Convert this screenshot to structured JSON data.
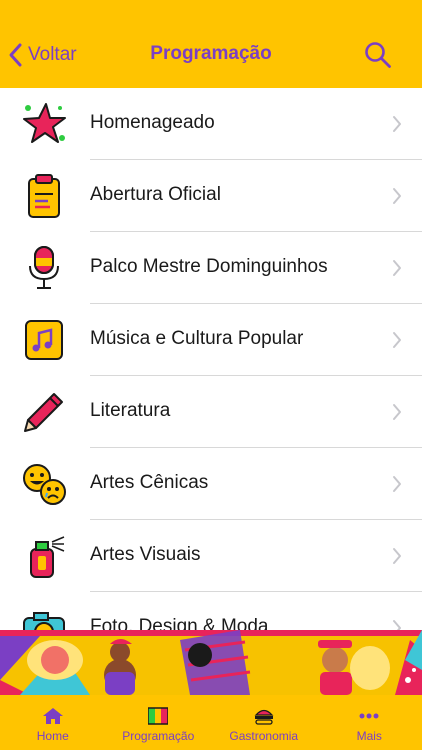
{
  "header": {
    "back_label": "Voltar",
    "title": "Programação",
    "back_icon": "chevron-left-icon",
    "search_icon": "search-icon"
  },
  "menu": {
    "items": [
      {
        "label": "Homenageado",
        "icon": "star-icon"
      },
      {
        "label": "Abertura Oficial",
        "icon": "clipboard-icon"
      },
      {
        "label": "Palco Mestre Dominguinhos",
        "icon": "microphone-icon"
      },
      {
        "label": "Música e Cultura Popular",
        "icon": "music-icon"
      },
      {
        "label": "Literatura",
        "icon": "pencil-icon"
      },
      {
        "label": "Artes Cênicas",
        "icon": "theater-masks-icon"
      },
      {
        "label": "Artes Visuais",
        "icon": "spray-can-icon"
      },
      {
        "label": "Foto, Design & Moda",
        "icon": "camera-icon"
      }
    ]
  },
  "tabbar": {
    "tabs": [
      {
        "label": "Home",
        "icon": "home-icon"
      },
      {
        "label": "Programação",
        "icon": "program-flag-icon"
      },
      {
        "label": "Gastronomia",
        "icon": "burger-icon"
      },
      {
        "label": "Mais",
        "icon": "more-dots-icon"
      }
    ]
  },
  "colors": {
    "header_bg": "#FFC400",
    "accent": "#7B3FC4",
    "chevron": "#C7C7CC",
    "divider": "#D8D8D8"
  }
}
